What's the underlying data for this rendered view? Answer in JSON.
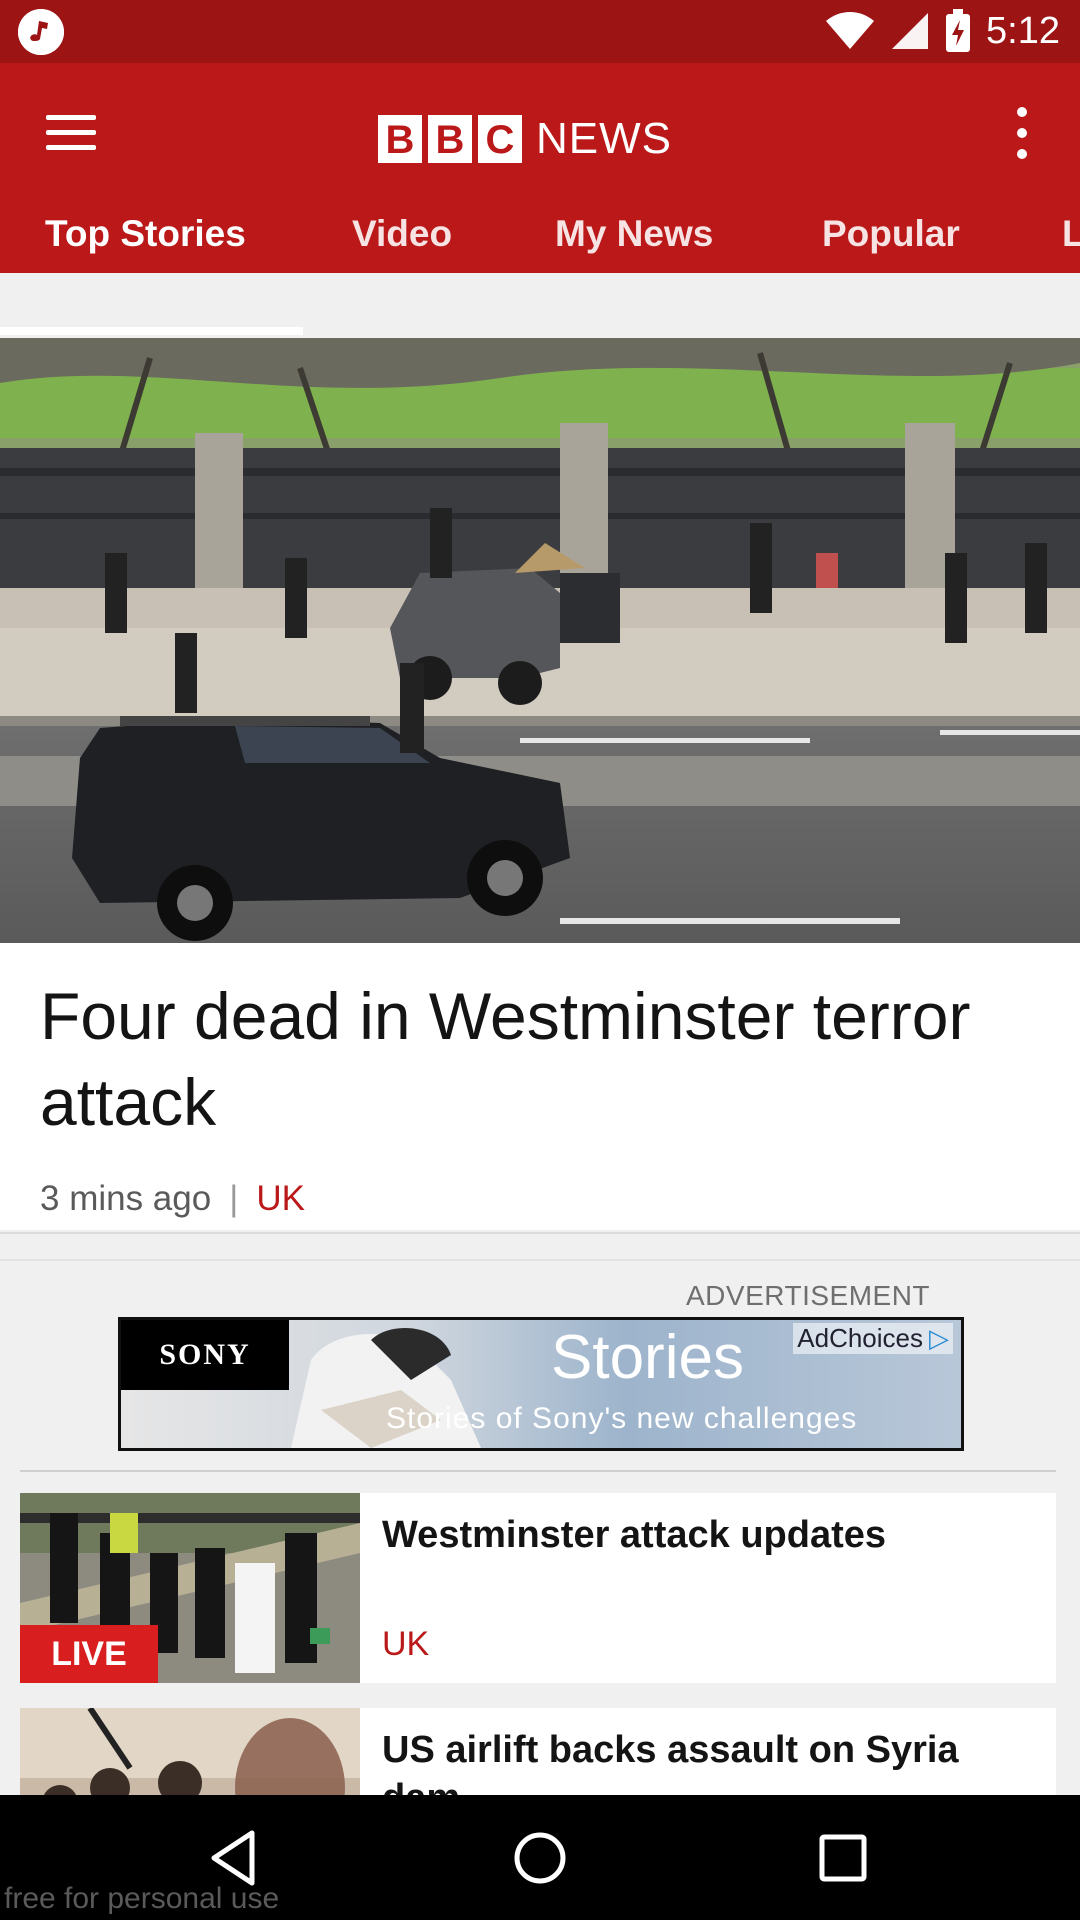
{
  "status_bar": {
    "time": "5:12",
    "icons": [
      "music-app-icon",
      "wifi-icon",
      "signal-icon",
      "battery-charging-icon"
    ]
  },
  "app_bar": {
    "logo_letters": [
      "B",
      "B",
      "C"
    ],
    "logo_word": "NEWS",
    "menu_icon": "hamburger-menu-icon",
    "overflow_icon": "more-vert-icon"
  },
  "tabs": [
    {
      "label": "Top Stories",
      "selected": true
    },
    {
      "label": "Video",
      "selected": false
    },
    {
      "label": "My News",
      "selected": false
    },
    {
      "label": "Popular",
      "selected": false
    },
    {
      "label": "L",
      "selected": false
    }
  ],
  "hero": {
    "title": "Four dead in Westminster terror attack",
    "time": "3 mins ago",
    "separator": "|",
    "category": "UK"
  },
  "ad": {
    "label": "ADVERTISEMENT",
    "brand": "SONY",
    "headline": "Stories",
    "subline": "Stories of Sony's new challenges",
    "adchoices": "AdChoices"
  },
  "stories": [
    {
      "title": "Westminster attack updates",
      "category": "UK",
      "badge": "LIVE"
    },
    {
      "title": "US airlift backs assault on Syria dam",
      "category": ""
    }
  ],
  "nav": [
    "back-icon",
    "home-icon",
    "recents-icon"
  ],
  "watermark": "free for personal use",
  "colors": {
    "brand_red": "#bb1919",
    "status_red": "#9c1414",
    "live_red": "#d81e1e"
  }
}
